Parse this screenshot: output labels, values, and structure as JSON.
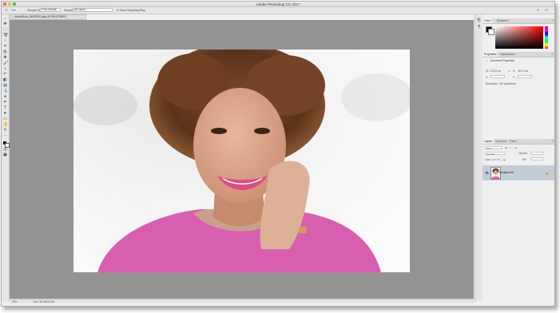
{
  "app": {
    "title": "Adobe Photoshop CC 2017"
  },
  "options_bar": {
    "sample_size_label": "Sample Size:",
    "sample_size_value": "Point Sample",
    "sample_label": "Sample:",
    "sample_value": "All Layers",
    "sampling_ring_label": "Show Sampling Ring"
  },
  "document": {
    "tab_title": "AdobeStock_84400010.jpeg @ 25% (RGB/8*)",
    "zoom": "25%",
    "doc_info": "Doc: 50.2M/50.2M"
  },
  "color_panel": {
    "tabs": [
      "Color",
      "Swatches"
    ],
    "active_tab": "Color",
    "foreground": "#000000",
    "background": "#ffffff"
  },
  "properties_panel": {
    "tabs": [
      "Properties",
      "Adjustments"
    ],
    "active_tab": "Properties",
    "section_title": "Document Properties",
    "width_label": "W:",
    "width_value": "67.83 cm",
    "height_label": "H:",
    "height_value": "45.21 cm",
    "x_label": "X:",
    "y_label": "Y:",
    "resolution": "Resolution: 300 pixels/inch"
  },
  "layers_panel": {
    "tabs": [
      "Layers",
      "Channels",
      "Paths"
    ],
    "active_tab": "Layers",
    "kind_filter": "Kind",
    "blend_mode": "Normal",
    "opacity_label": "Opacity:",
    "lock_label": "Lock:",
    "fill_label": "Fill:",
    "layers": [
      {
        "name": "Background",
        "visible": true,
        "locked": true
      }
    ]
  },
  "colors": {
    "accent_selected_layer": "#c4cdd6",
    "canvas_bg": "#939393"
  }
}
